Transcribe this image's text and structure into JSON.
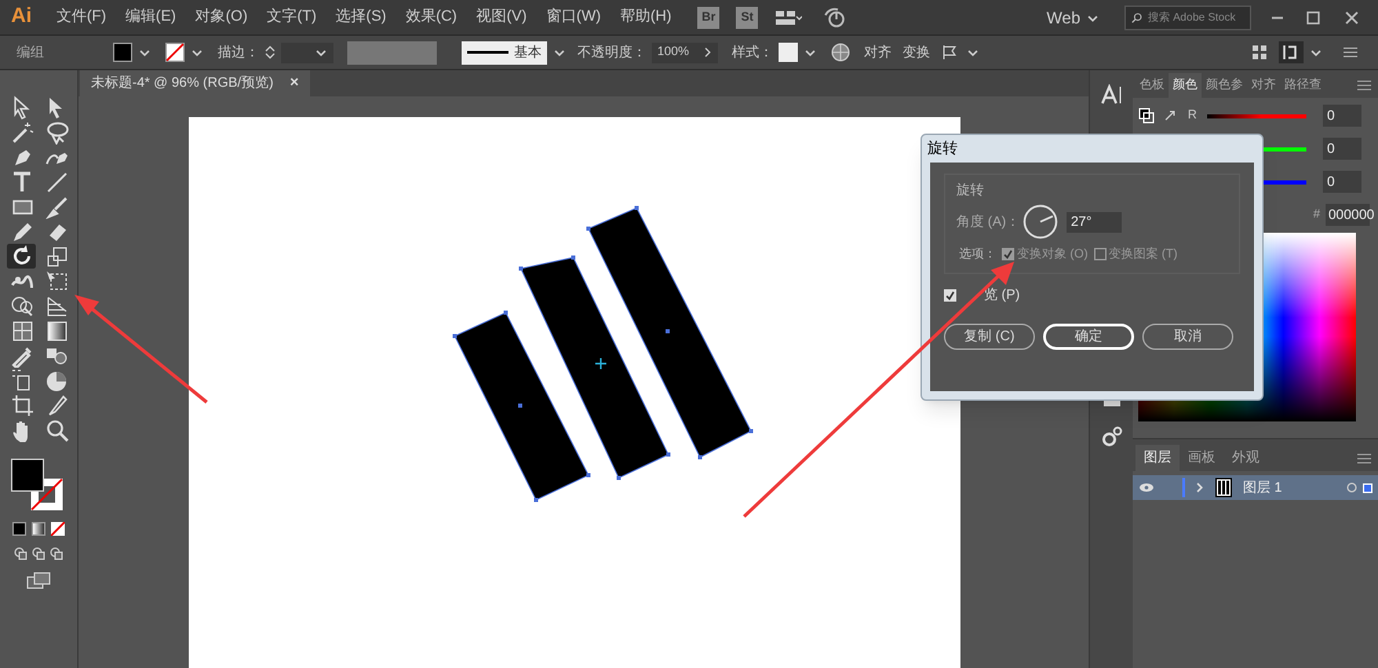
{
  "menu_bar": {
    "logo": "Ai",
    "menus": [
      "文件(F)",
      "编辑(E)",
      "对象(O)",
      "文字(T)",
      "选择(S)",
      "效果(C)",
      "视图(V)",
      "窗口(W)",
      "帮助(H)"
    ],
    "apps": [
      "Br",
      "St"
    ],
    "workspace": "Web",
    "search": {
      "placeholder": "搜索 Adobe Stock"
    }
  },
  "control_bar": {
    "selection": "编组",
    "stroke_label": "描边：",
    "stroke_profile": "基本",
    "opacity_label": "不透明度：",
    "opacity": "100%",
    "style_label": "样式：",
    "align": "对齐",
    "transform": "变换"
  },
  "document_tab": {
    "title": "未标题-4* @ 96% (RGB/预览)",
    "close": "×"
  },
  "tools": [
    {
      "selected": false
    },
    {
      "selected": false
    },
    {
      "selected": false
    },
    {
      "selected": false
    },
    {
      "selected": false
    },
    {
      "selected": false
    },
    {
      "selected": false
    },
    {
      "selected": false
    },
    {
      "selected": false
    },
    {
      "selected": false
    },
    {
      "selected": false
    },
    {
      "selected": false
    },
    {
      "selected": true
    },
    {
      "selected": false
    },
    {
      "selected": false
    },
    {
      "selected": false
    },
    {
      "selected": false
    },
    {
      "selected": false
    },
    {
      "selected": false
    },
    {
      "selected": false
    },
    {
      "selected": false
    },
    {
      "selected": false
    },
    {
      "selected": false
    },
    {
      "selected": false
    },
    {
      "selected": false
    },
    {
      "selected": false
    },
    {
      "selected": false
    },
    {
      "selected": false
    }
  ],
  "dialog": {
    "title": "旋转",
    "group": "旋转",
    "angle_label": "角度 (A)：",
    "angle": "27°",
    "options_label": "选项：",
    "options": [
      {
        "label": "变换对象 (O)",
        "checked": true,
        "disabled": true
      },
      {
        "label": "变换图案 (T)",
        "checked": false,
        "disabled": true
      }
    ],
    "preview": {
      "label": "览 (P)",
      "checked": true
    },
    "buttons": [
      {
        "label": "复制 (C)",
        "default": false
      },
      {
        "label": "确定",
        "default": true
      },
      {
        "label": "取消",
        "default": false
      }
    ]
  },
  "color_panel": {
    "tabs": [
      {
        "label": "色板",
        "selected": false
      },
      {
        "label": "颜色",
        "selected": true
      },
      {
        "label": "颜色参",
        "selected": false
      },
      {
        "label": "对齐",
        "selected": false
      },
      {
        "label": "路径查",
        "selected": false
      }
    ],
    "channels": [
      {
        "label": "R",
        "value": "0",
        "color": "#ff0000"
      },
      {
        "value": "0",
        "color": "#00ff00"
      },
      {
        "value": "0",
        "color": "#0000ff"
      }
    ],
    "hex_label": "#",
    "hex": "000000"
  },
  "layers_panel": {
    "tabs": [
      {
        "label": "图层",
        "selected": true
      },
      {
        "label": "画板",
        "selected": false
      },
      {
        "label": "外观",
        "selected": false
      }
    ],
    "layers": [
      {
        "name": "图层 1",
        "visible": true,
        "selected": true
      }
    ]
  }
}
